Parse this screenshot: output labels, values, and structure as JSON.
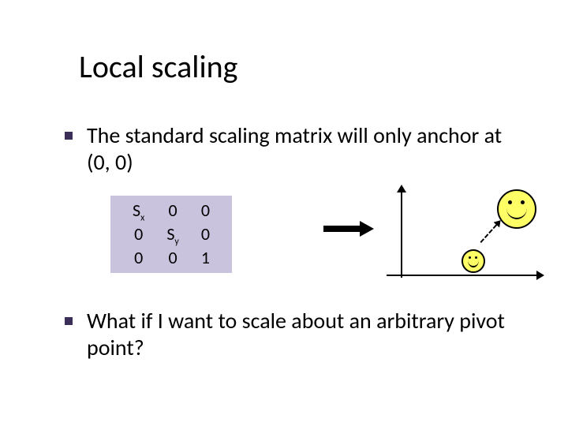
{
  "title": "Local scaling",
  "bullets": {
    "b1": "The standard scaling matrix will only anchor at (0, 0)",
    "b2": "What if I want to scale about an arbitrary pivot point?"
  },
  "matrix": {
    "r0c0": "S",
    "r0c0_sub": "x",
    "r0c1": "0",
    "r0c2": "0",
    "r1c0": "0",
    "r1c1": "S",
    "r1c1_sub": "y",
    "r1c2": "0",
    "r2c0": "0",
    "r2c1": "0",
    "r2c2": "1"
  }
}
